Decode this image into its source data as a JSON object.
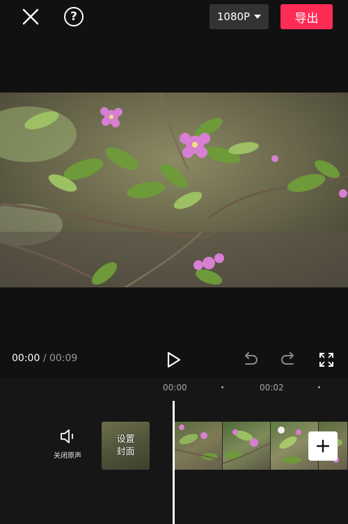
{
  "topbar": {
    "close_icon": "close-icon",
    "help_icon": "help-icon",
    "help_glyph": "?",
    "resolution": "1080P",
    "export_label": "导出",
    "export_color": "#fe2c55"
  },
  "preview": {
    "content": "video frame"
  },
  "playback": {
    "current_time": "00:00",
    "separator": "/",
    "duration": "00:09"
  },
  "timeline": {
    "ruler": [
      "00:00",
      "00:02"
    ],
    "mute_label": "关闭原声",
    "cover_line1": "设置",
    "cover_line2": "封面"
  }
}
